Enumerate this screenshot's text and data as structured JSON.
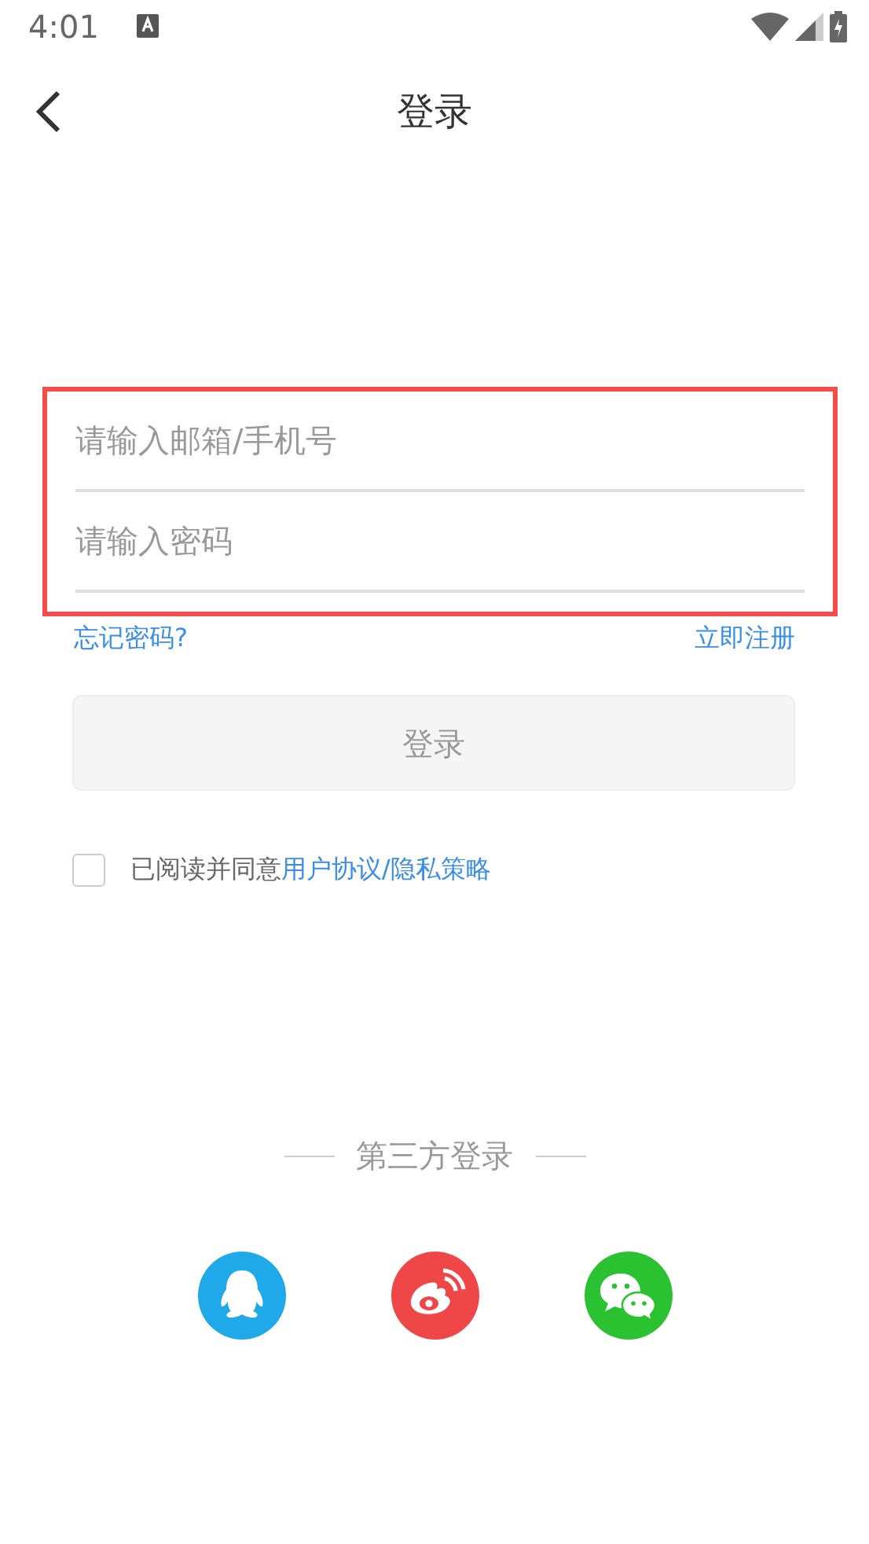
{
  "status_bar": {
    "time": "4:01"
  },
  "header": {
    "title": "登录"
  },
  "form": {
    "highlighted": true,
    "fields": [
      {
        "placeholder": "请输入邮箱/手机号"
      },
      {
        "placeholder": "请输入密码"
      }
    ]
  },
  "links": {
    "forgot": "忘记密码?",
    "register": "立即注册"
  },
  "login_button": {
    "label": "登录",
    "disabled": true
  },
  "agreement": {
    "checked": false,
    "text": "已阅读并同意",
    "terms": "用户协议",
    "separator": "/",
    "privacy": "隐私策略"
  },
  "third_party": {
    "title": "第三方登录",
    "providers": [
      {
        "kind": "qq",
        "color": "#20a9e8"
      },
      {
        "kind": "weibo",
        "color": "#ef4648"
      },
      {
        "kind": "wechat",
        "color": "#2bc232"
      }
    ]
  }
}
